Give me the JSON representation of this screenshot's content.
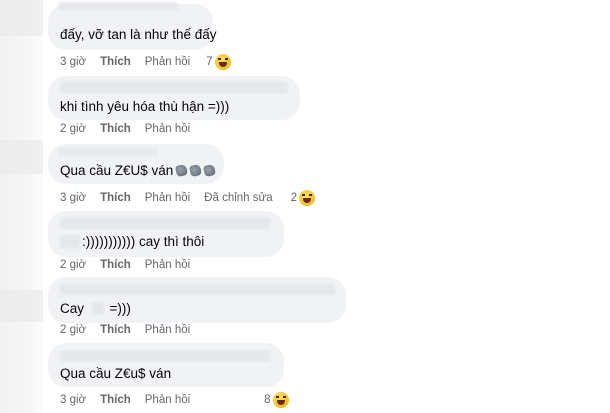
{
  "comments": [
    {
      "text": "đấy, vỡ tan là như thế đấy",
      "time": "3 giờ",
      "like": "Thích",
      "reply": "Phản hồi",
      "edited": "",
      "reaction": {
        "icon": "haha-icon",
        "count": "7"
      }
    },
    {
      "text": "khi tình yêu hóa thù hận =)))",
      "time": "2 giờ",
      "like": "Thích",
      "reply": "Phản hồi",
      "edited": "",
      "reaction": null
    },
    {
      "text": "Qua cầu Z€U$ ván",
      "emojis": [
        "fist-icon",
        "fist-icon",
        "fist-icon"
      ],
      "time": "3 giờ",
      "like": "Thích",
      "reply": "Phản hồi",
      "edited": "Đã chỉnh sửa",
      "reaction": {
        "icon": "haha-icon",
        "count": "2"
      }
    },
    {
      "text": ":))))))))))) cay thì thôi",
      "time": "2 giờ",
      "like": "Thích",
      "reply": "Phản hồi",
      "edited": "",
      "reaction": null
    },
    {
      "text_a": "Cay",
      "text_b": "=)))",
      "time": "2 giờ",
      "like": "Thích",
      "reply": "Phản hồi",
      "edited": "",
      "reaction": null
    },
    {
      "text": "Qua cầu Z€u$ ván",
      "time": "3 giờ",
      "like": "Thích",
      "reply": "Phản hồi",
      "edited": "",
      "reaction": {
        "icon": "haha-icon",
        "count": "8"
      }
    }
  ],
  "colors": {
    "bubble": "#f0f2f5",
    "meta": "#65676b",
    "text": "#050505"
  }
}
